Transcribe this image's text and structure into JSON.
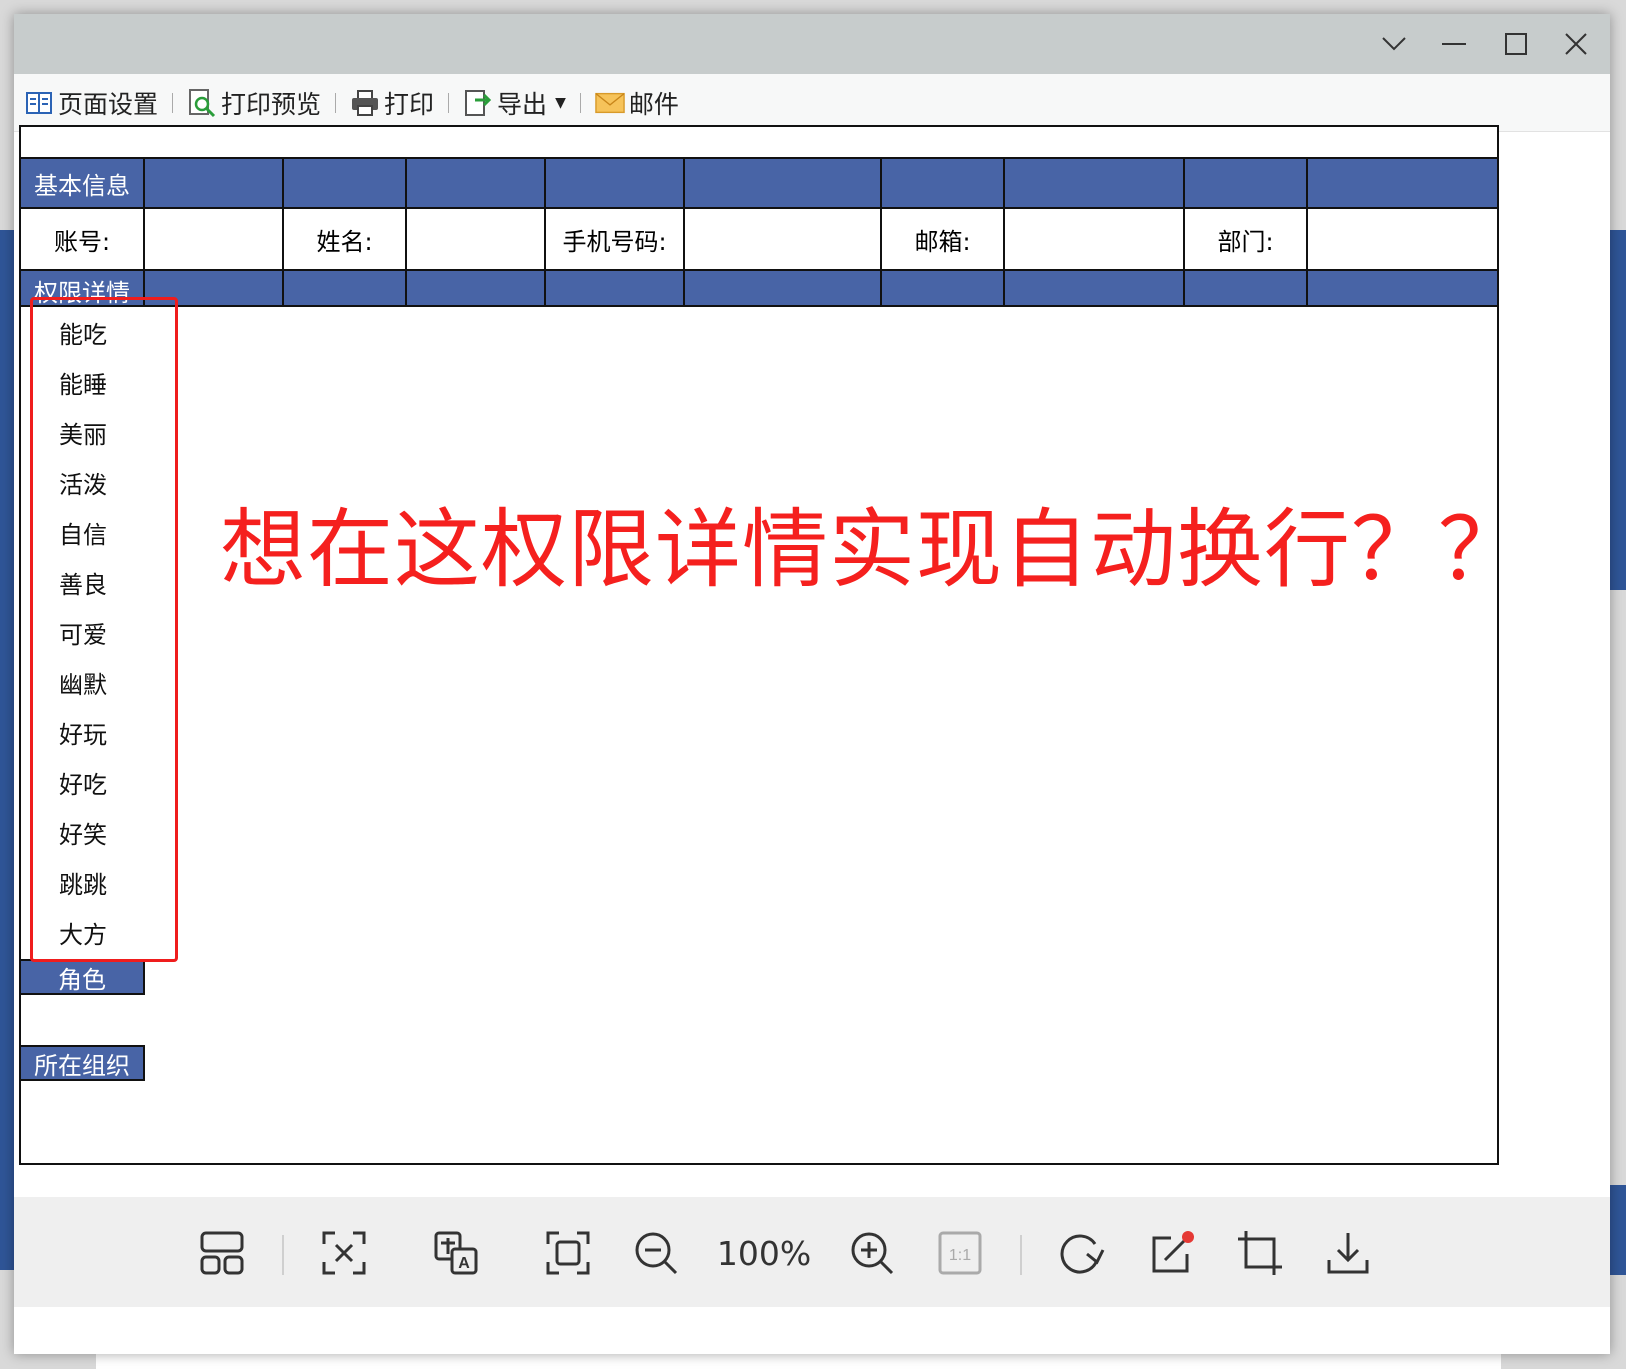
{
  "toolbar": {
    "page_setup": "页面设置",
    "print_preview": "打印预览",
    "print": "打印",
    "export": "导出",
    "mail": "邮件"
  },
  "report": {
    "section_basic": "基本信息",
    "fields": {
      "account": "账号:",
      "name": "姓名:",
      "phone": "手机号码:",
      "email": "邮箱:",
      "department": "部门:"
    },
    "section_permission": "权限详情",
    "permissions": [
      "能吃",
      "能睡",
      "美丽",
      "活泼",
      "自信",
      "善良",
      "可爱",
      "幽默",
      "好玩",
      "好吃",
      "好笑",
      "跳跳",
      "大方"
    ],
    "section_role": "角色",
    "section_org": "所在组织"
  },
  "annotation": "想在这权限详情实现自动换行？？",
  "viewer": {
    "zoom": "100%"
  },
  "colors": {
    "header_blue": "#4864a6",
    "annotation_red": "#f5201e"
  }
}
